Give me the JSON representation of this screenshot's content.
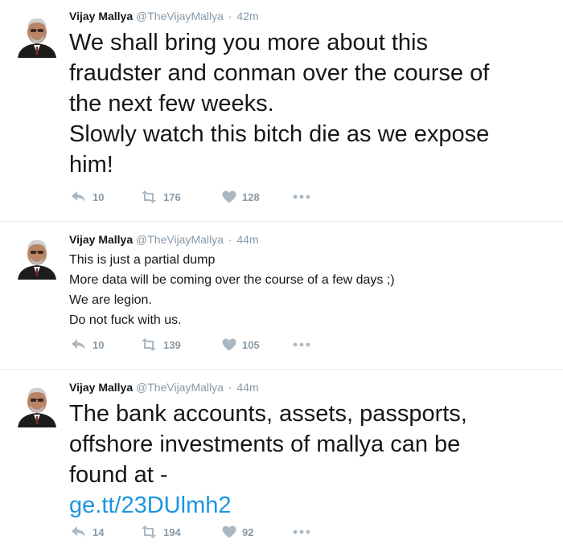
{
  "tweets": [
    {
      "author_name": "Vijay Mallya",
      "handle": "@TheVijayMallya",
      "separator": "·",
      "time": "42m",
      "text": "We shall bring you more about this\nfraudster and conman over the course of\nthe next few weeks.\nSlowly watch this bitch die as we expose\nhim!",
      "replies": "10",
      "retweets": "176",
      "likes": "128"
    },
    {
      "author_name": "Vijay Mallya",
      "handle": "@TheVijayMallya",
      "separator": "·",
      "time": "44m",
      "text": "This is just a partial dump\nMore data will be coming over the course of a few days ;)\nWe are legion.\nDo not fuck with us.",
      "replies": "10",
      "retweets": "139",
      "likes": "105"
    },
    {
      "author_name": "Vijay Mallya",
      "handle": "@TheVijayMallya",
      "separator": "·",
      "time": "44m",
      "text": "The bank accounts, assets, passports,\noffshore investments of mallya can be\nfound at -",
      "link": "ge.tt/23DUlmh2",
      "replies": "14",
      "retweets": "194",
      "likes": "92"
    }
  ],
  "icons": {
    "reply": "reply-icon",
    "retweet": "retweet-icon",
    "like": "heart-icon",
    "more": "more-icon"
  },
  "colors": {
    "text": "#14171a",
    "muted": "#8899a6",
    "link": "#1b95e0",
    "divider": "#e6ecf0",
    "icon": "#aab8c2"
  }
}
